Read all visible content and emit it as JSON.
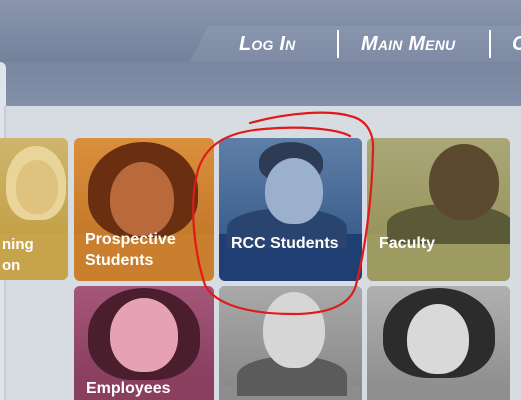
{
  "nav": {
    "login_label": "Log In",
    "main_menu_label": "Main Menu",
    "partial_label": "C"
  },
  "tiles": [
    {
      "name": "Prospective Students",
      "line1": "Prospective",
      "line2": "Students"
    },
    {
      "name": "RCC Students",
      "line1": "RCC Students"
    },
    {
      "name": "Faculty",
      "line1": "Faculty"
    },
    {
      "name": "partial-left",
      "line1": "ning",
      "line2": "on"
    },
    {
      "name": "Employees",
      "line1": "Employees"
    }
  ],
  "colors": {
    "prospective": "#c97f2e",
    "rcc": "#1f3f73",
    "faculty": "#9d9a62",
    "partial_left": "#c7a34b",
    "employees": "#8a3f5f",
    "grey_tile": "#8d8d8d",
    "annotation": "#e01a1a"
  }
}
